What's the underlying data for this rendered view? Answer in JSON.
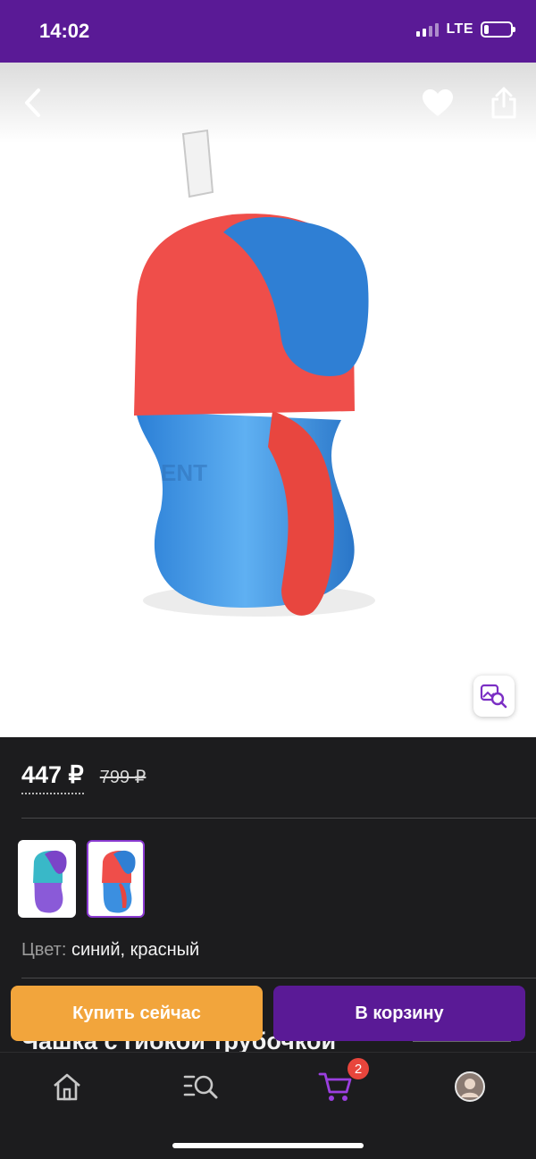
{
  "status_bar": {
    "time": "14:02",
    "network": "LTE"
  },
  "product": {
    "price_current": "447 ₽",
    "price_old": "799 ₽",
    "color_label": "Цвет:",
    "color_value": "синий, красный",
    "title_partial": "Чашка с гибкой трубочкой"
  },
  "actions": {
    "buy_now_label": "Купить сейчас",
    "add_to_cart_label": "В корзину"
  },
  "tab_bar": {
    "cart_badge": "2"
  },
  "icons": {
    "back": "chevron-left-icon",
    "favorite": "heart-icon",
    "share": "share-icon",
    "visual_search": "image-search-icon",
    "home": "home-icon",
    "catalog": "catalog-search-icon",
    "cart": "cart-icon",
    "profile": "avatar-icon"
  },
  "colors": {
    "brand_purple": "#5a1a96",
    "buy_orange": "#f2a53c",
    "badge_red": "#e8453c",
    "accent_violet": "#8a3ad1"
  }
}
